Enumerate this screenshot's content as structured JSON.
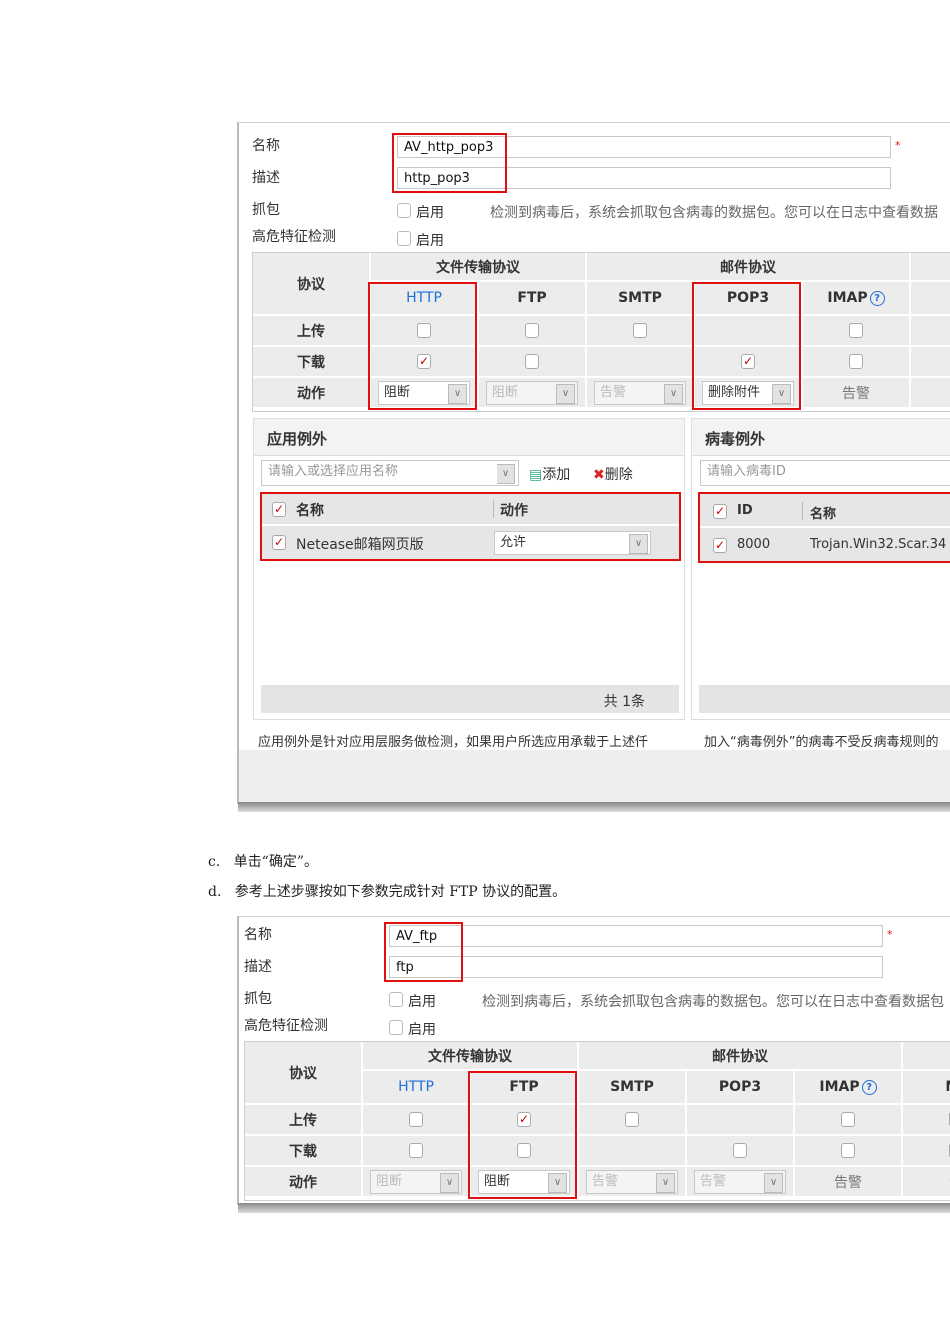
{
  "panels": [
    {
      "fields": {
        "name_label": "名称",
        "name_value": "AV_http_pop3",
        "desc_label": "描述",
        "desc_value": "http_pop3",
        "capture_label": "抓包",
        "capture_enable": "启用",
        "capture_hint": "检测到病毒后，系统会抓取包含病毒的数据包。您可以在日志中查看数据",
        "risk_label": "高危特征检测",
        "risk_enable": "启用",
        "required_mark": "*"
      },
      "table": {
        "protocol_label": "协议",
        "group_file": "文件传输协议",
        "group_mail": "邮件协议",
        "row_labels": [
          "上传",
          "下载",
          "动作"
        ],
        "columns": [
          {
            "name": "HTTP",
            "link": true,
            "up": false,
            "down": true,
            "action": {
              "kind": "select",
              "value": "阻断",
              "disabled": false
            },
            "highlight": true
          },
          {
            "name": "FTP",
            "up": false,
            "down": false,
            "action": {
              "kind": "select",
              "value": "阻断",
              "disabled": true
            }
          },
          {
            "name": "SMTP",
            "up": false,
            "down": null,
            "action": {
              "kind": "select",
              "value": "告警",
              "disabled": true
            }
          },
          {
            "name": "POP3",
            "up": null,
            "down": true,
            "action": {
              "kind": "select",
              "value": "删除附件",
              "disabled": false
            },
            "highlight": true
          },
          {
            "name": "IMAP",
            "help": true,
            "up": false,
            "down": false,
            "action": {
              "kind": "text",
              "value": "告警"
            }
          },
          {
            "name": "N",
            "up": null,
            "down": null,
            "action": {
              "kind": "text",
              "value": "-"
            }
          }
        ]
      },
      "app_exception": {
        "title": "应用例外",
        "placeholder": "请输入或选择应用名称",
        "add": "添加",
        "delete": "删除",
        "col_name": "名称",
        "col_action": "动作",
        "row_name": "Netease邮箱网页版",
        "row_action": "允许",
        "footer": "共 1条",
        "note": "应用例外是针对应用层服务做检测，如果用户所选应用承载于上述仟"
      },
      "virus_exception": {
        "title": "病毒例外",
        "placeholder": "请输入病毒ID",
        "col_id": "ID",
        "col_name": "名称",
        "row_id": "8000",
        "row_name": "Trojan.Win32.Scar.34",
        "note": "加入“病毒例外”的病毒不受反病毒规则的"
      }
    },
    {
      "fields": {
        "name_label": "名称",
        "name_value": "AV_ftp",
        "desc_label": "描述",
        "desc_value": "ftp",
        "capture_label": "抓包",
        "capture_enable": "启用",
        "capture_hint": "检测到病毒后，系统会抓取包含病毒的数据包。您可以在日志中查看数据包",
        "risk_label": "高危特征检测",
        "risk_enable": "启用",
        "required_mark": "*"
      },
      "table": {
        "protocol_label": "协议",
        "group_file": "文件传输协议",
        "group_mail": "邮件协议",
        "row_labels": [
          "上传",
          "下载",
          "动作"
        ],
        "columns": [
          {
            "name": "HTTP",
            "link": true,
            "up": false,
            "down": false,
            "action": {
              "kind": "select",
              "value": "阻断",
              "disabled": true
            }
          },
          {
            "name": "FTP",
            "up": true,
            "down": false,
            "action": {
              "kind": "select",
              "value": "阻断",
              "disabled": false
            },
            "highlight": true
          },
          {
            "name": "SMTP",
            "up": false,
            "down": null,
            "action": {
              "kind": "select",
              "value": "告警",
              "disabled": true
            }
          },
          {
            "name": "POP3",
            "up": null,
            "down": false,
            "action": {
              "kind": "select",
              "value": "告警",
              "disabled": true
            }
          },
          {
            "name": "IMAP",
            "help": true,
            "up": false,
            "down": false,
            "action": {
              "kind": "text",
              "value": "告警"
            }
          },
          {
            "name": "NF",
            "up": false,
            "down": false,
            "action": {
              "kind": "text",
              "value": "告"
            }
          }
        ]
      }
    }
  ],
  "steps": [
    {
      "marker": "c.",
      "text": "单击“确定”。"
    },
    {
      "marker": "d.",
      "text": "参考上述步骤按如下参数完成针对 FTP 协议的配置。"
    }
  ],
  "colors": {
    "highlight": "#e01010",
    "link": "#1e6fd9",
    "check": "#c00000"
  }
}
